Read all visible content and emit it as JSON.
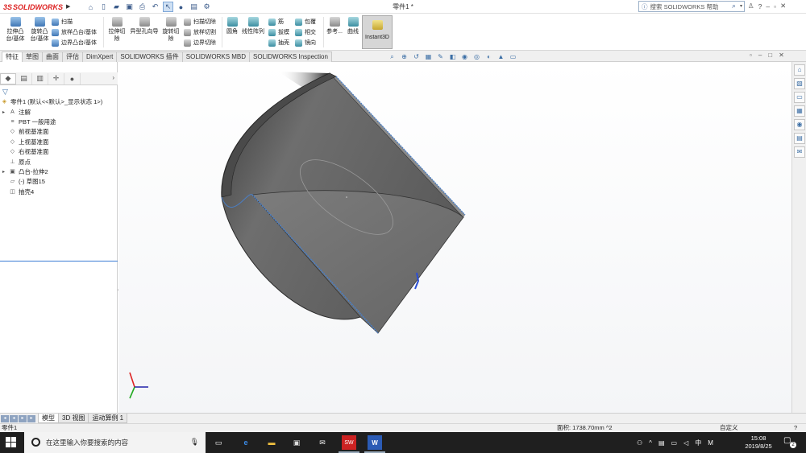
{
  "app": {
    "logo_ds": "3S",
    "logo_name": "SOLIDWORKS",
    "document_title": "零件1 *",
    "search_placeholder": "搜索 SOLIDWORKS 帮助",
    "brand_color": "#d22222"
  },
  "quick_access": {
    "icons": [
      "home-icon",
      "new-icon",
      "open-icon",
      "save-icon",
      "print-icon",
      "undo-icon",
      "select-icon",
      "rebuild-icon",
      "file-props-icon",
      "options-icon"
    ]
  },
  "title_right": {
    "user": "♙",
    "help": "?",
    "minimize": "–",
    "restore": "▫",
    "close": "✕"
  },
  "ribbon": {
    "extrude_boss": "拉伸凸\n台/基体",
    "revolve_boss": "旋转凸\n台/基体",
    "sweep": "扫描",
    "loft": "放样凸台/基体",
    "boundary_boss": "边界凸台/基体",
    "extrude_cut": "拉伸切\n除",
    "hole_wizard": "异型孔向导",
    "revolve_cut": "旋转切\n除",
    "swept_cut": "扫描切除",
    "lofted_cut": "放样切割",
    "boundary_cut": "边界切除",
    "fillet": "圆角",
    "linear_pattern": "线性阵列",
    "rib": "筋",
    "draft": "拔模",
    "shell": "抽壳",
    "wrap": "包覆",
    "intersect": "相交",
    "mirror": "镜向",
    "reference": "参考...",
    "curves": "曲线",
    "instant3d": "Instant3D"
  },
  "tabs": [
    "特征",
    "草图",
    "曲面",
    "评估",
    "DimXpert",
    "SOLIDWORKS 插件",
    "SOLIDWORKS MBD",
    "SOLIDWORKS Inspection"
  ],
  "active_tab": 0,
  "tree": {
    "items": [
      {
        "label": "零件1 (默认<<默认>_显示状态 1>)",
        "icon": "part-icon",
        "expand": "",
        "indent": 0
      },
      {
        "label": "注解",
        "icon": "annotations-icon",
        "expand": "▸",
        "indent": 1
      },
      {
        "label": "PBT 一般用途",
        "icon": "material-icon",
        "expand": "",
        "indent": 1
      },
      {
        "label": "前视基准面",
        "icon": "plane-icon",
        "expand": "",
        "indent": 1
      },
      {
        "label": "上视基准面",
        "icon": "plane-icon",
        "expand": "",
        "indent": 1
      },
      {
        "label": "右视基准面",
        "icon": "plane-icon",
        "expand": "",
        "indent": 1
      },
      {
        "label": "原点",
        "icon": "origin-icon",
        "expand": "",
        "indent": 1
      },
      {
        "label": "凸台-拉伸2",
        "icon": "extrude-icon",
        "expand": "▸",
        "indent": 1
      },
      {
        "label": "(-) 草图15",
        "icon": "sketch-icon",
        "expand": "",
        "indent": 1
      },
      {
        "label": "抽壳4",
        "icon": "shell-icon",
        "expand": "",
        "indent": 1
      }
    ]
  },
  "bottom_tabs": [
    "模型",
    "3D 视图",
    "运动算例 1"
  ],
  "status": {
    "left": "零件1",
    "area": "面积: 1738.70mm ^2",
    "unit": "自定义",
    "help": "?"
  },
  "taskbar": {
    "search_placeholder": "在这里输入你要搜索的内容",
    "tray_keyboard": "中",
    "tray_ime": "M",
    "time": "15:08",
    "date": "2019/8/25",
    "notification_count": "2"
  }
}
